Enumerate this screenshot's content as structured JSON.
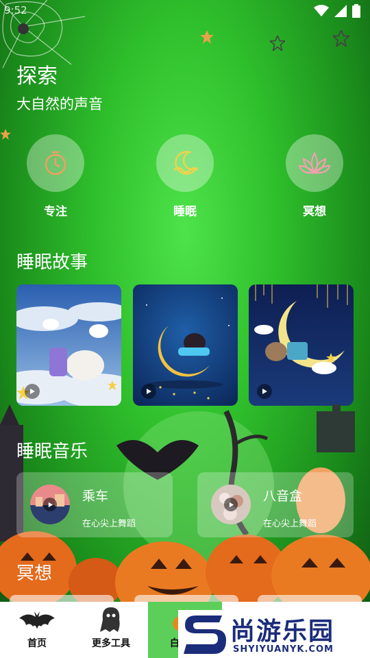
{
  "status_bar": {
    "time": "9:52"
  },
  "header": {
    "title": "探索",
    "subtitle": "大自然的声音"
  },
  "categories": [
    {
      "label": "专注",
      "icon": "stopwatch-icon"
    },
    {
      "label": "睡眠",
      "icon": "moon-icon"
    },
    {
      "label": "冥想",
      "icon": "lotus-icon"
    }
  ],
  "sections": {
    "stories": "睡眠故事",
    "music": "睡眠音乐",
    "meditate": "冥想"
  },
  "stories": [
    {
      "scene": "sheep-on-clouds"
    },
    {
      "scene": "girl-on-moon"
    },
    {
      "scene": "bear-on-moon"
    }
  ],
  "music": [
    {
      "title": "乘车",
      "subtitle": "在心尖上舞蹈"
    },
    {
      "title": "八音盒",
      "subtitle": "在心尖上舞蹈"
    }
  ],
  "nav": [
    {
      "label": "首页",
      "icon": "bat-icon"
    },
    {
      "label": "更多工具",
      "icon": "ghost-icon"
    },
    {
      "label": "白",
      "icon": "pumpkin-icon"
    }
  ],
  "watermark": {
    "text": "尚游乐园",
    "url": "SHYIYUANYK.COM"
  },
  "colors": {
    "accent_green": "#5ccf5a",
    "watermark_blue": "#1b2c7a"
  }
}
